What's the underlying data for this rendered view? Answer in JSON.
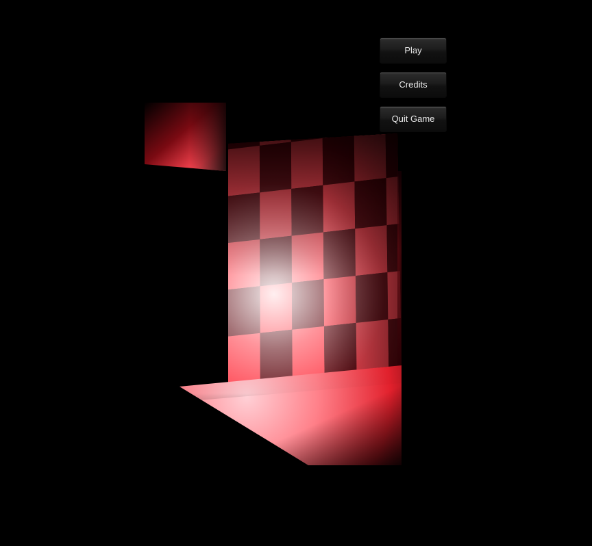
{
  "menu": {
    "play_label": "Play",
    "credits_label": "Credits",
    "quit_label": "Quit Game"
  },
  "colors": {
    "background": "#000000",
    "light_red": "#ff3b48",
    "highlight": "#ffe8ee",
    "dark_red": "#5a0008",
    "button_text": "#eaeaea"
  }
}
